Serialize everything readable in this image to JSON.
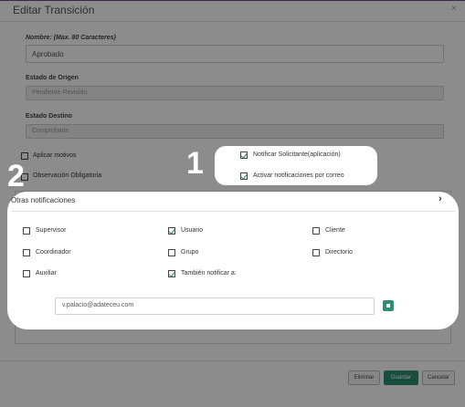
{
  "modal": {
    "title": "Editar Transición",
    "close": "×"
  },
  "form": {
    "name_label": "Nombre: (Max. 80 Caracteres)",
    "name_value": "Aprobado",
    "origin_label": "Estado de Origen",
    "origin_value": "Pendiente Revisión",
    "dest_label": "Estado Destino",
    "dest_value": "Comprobado",
    "apply_reasons_label": "Aplicar motivos",
    "mandatory_obs_label": "Observación Obligatoria",
    "notify_requester_label": "Notificar Solicitante(aplicación)",
    "email_notify_label": "Activar notificaciones por correo"
  },
  "other": {
    "title": "Otras notificaciones",
    "chevron": "›",
    "options": {
      "supervisor": "Supervisor",
      "usuario": "Usuario",
      "cliente": "Cliente",
      "coordinador": "Coordinador",
      "grupo": "Grupo",
      "directorio": "Directorio",
      "auxiliar": "Auxiliar",
      "tambien": "También notificar a:"
    },
    "email_value": "v.palacio@adateceu.com"
  },
  "footer": {
    "delete": "Eliminar",
    "save": "Guardar",
    "cancel": "Cancelar"
  },
  "annotations": {
    "one": "1",
    "two": "2"
  }
}
